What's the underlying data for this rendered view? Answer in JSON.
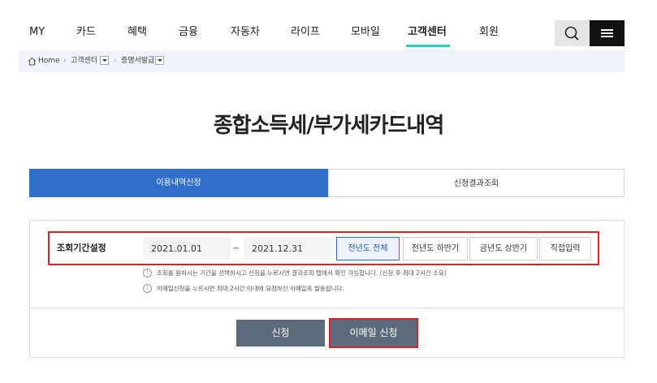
{
  "nav": {
    "items": [
      "MY",
      "카드",
      "혜택",
      "금융",
      "자동차",
      "라이프",
      "모바일",
      "고객센터",
      "회원"
    ],
    "active_index": 7,
    "accent_color": "#2bd4b0"
  },
  "icons": {
    "search": "search-icon",
    "menu": "hamburger-menu-icon",
    "home": "home-icon",
    "info": "info-icon"
  },
  "breadcrumb": {
    "home": "Home",
    "level1": "고객센터",
    "level2": "증명서발급"
  },
  "page_title": "종합소득세/부가세카드내역",
  "tabs": [
    {
      "label": "이용내역신청",
      "active": true
    },
    {
      "label": "신청결과조회",
      "active": false
    }
  ],
  "form": {
    "period_label": "조회기간설정",
    "start_date": "2021.01.01",
    "separator": "~",
    "end_date": "2021.12.31",
    "period_options": [
      {
        "label": "전년도 전체",
        "selected": true
      },
      {
        "label": "전년도 하반기",
        "selected": false
      },
      {
        "label": "금년도 상반기",
        "selected": false
      },
      {
        "label": "직접입력",
        "selected": false
      }
    ],
    "notes": [
      "조회를 원하시는 기간을 선택하시고 신청을 누르시면 결과조회 탭에서 확인 가능합니다. (신청 후 최대 2시간 소요)",
      "이메일신청을 누르시면 최대 2시간 이내에 요청하신 이메일로 발송됩니다."
    ]
  },
  "actions": {
    "apply": "신청",
    "email_apply": "이메일 신청"
  },
  "colors": {
    "primary": "#2f6fcb",
    "button": "#5c6b7c",
    "highlight": "#d9232a"
  }
}
